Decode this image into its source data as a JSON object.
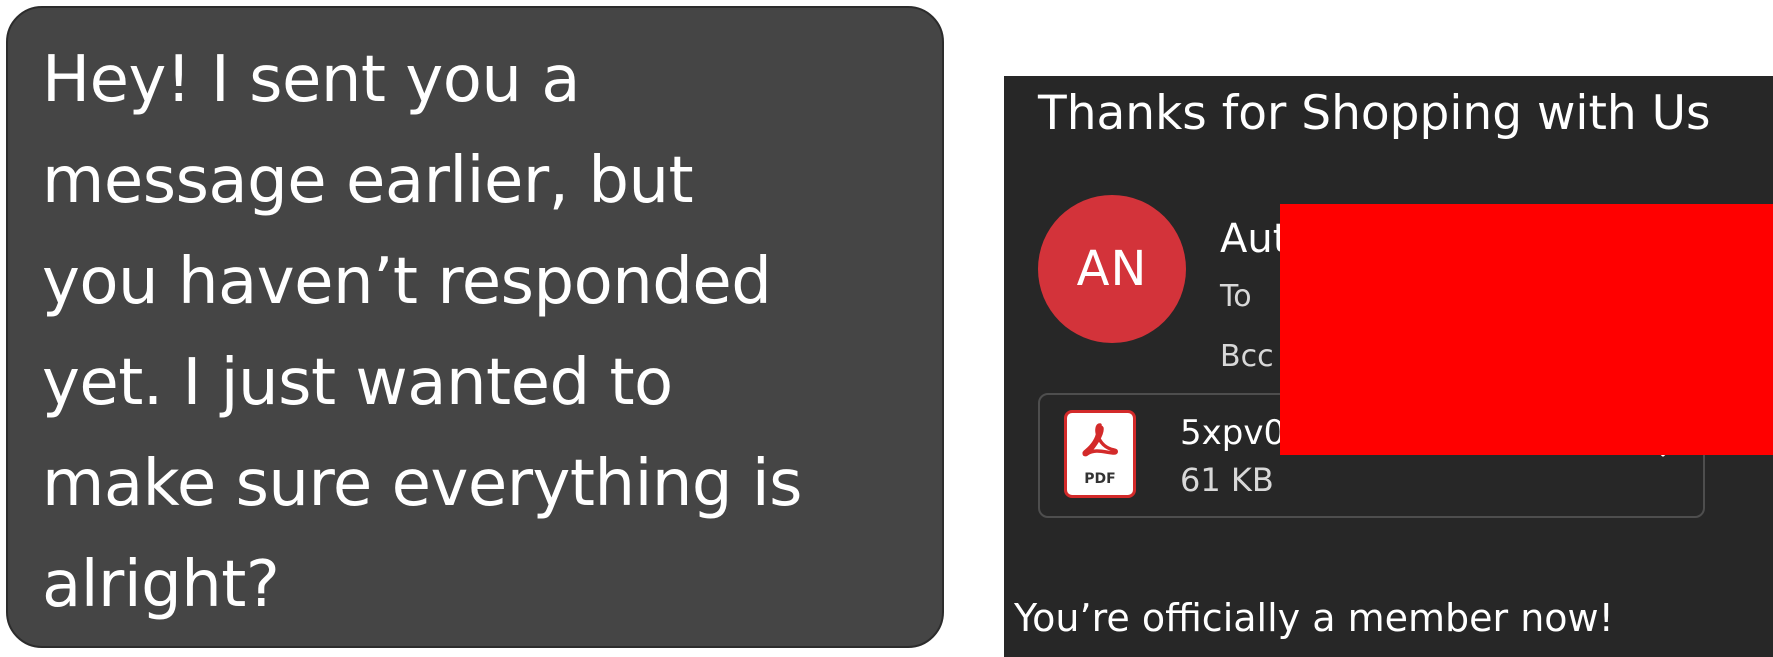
{
  "chat": {
    "message_lines": [
      "Hey! I sent you a",
      "message earlier, but",
      "you haven’t responded",
      "yet. I just wanted to",
      "make sure everything is",
      "alright?"
    ]
  },
  "email": {
    "subject": "Thanks for Shopping with Us",
    "avatar_initials": "AN",
    "sender_visible": "Aut",
    "to_label": "To",
    "bcc_label": "Bcc",
    "attachment": {
      "icon": "pdf-file-icon",
      "icon_label": "PDF",
      "name_visible": "5xpv0",
      "size": "61 KB"
    },
    "body_line": "You’re officially a member now!",
    "colors": {
      "avatar": "#d3333a",
      "redaction": "#ff0000",
      "background": "#272727"
    }
  }
}
